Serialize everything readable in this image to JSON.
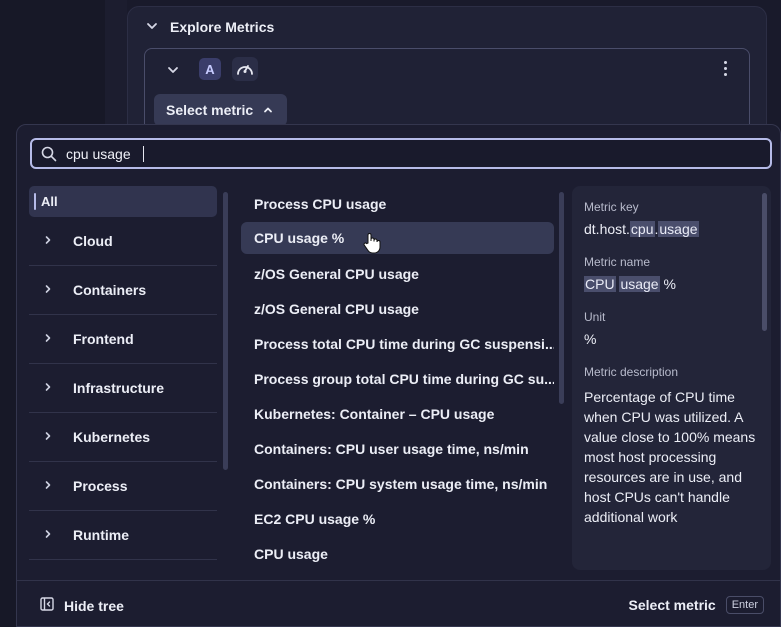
{
  "explore": {
    "title": "Explore Metrics",
    "query_badge": "A",
    "select_metric_label": "Select metric"
  },
  "search": {
    "value": "cpu usage"
  },
  "tree": {
    "all_label": "All",
    "items": [
      {
        "label": "Cloud"
      },
      {
        "label": "Containers"
      },
      {
        "label": "Frontend"
      },
      {
        "label": "Infrastructure"
      },
      {
        "label": "Kubernetes"
      },
      {
        "label": "Process"
      },
      {
        "label": "Runtime"
      }
    ]
  },
  "results": [
    {
      "label": "Process CPU usage"
    },
    {
      "label": "CPU usage %",
      "selected": true
    },
    {
      "label": "z/OS General CPU usage"
    },
    {
      "label": "z/OS General CPU usage"
    },
    {
      "label": "Process total CPU time during GC suspensi..."
    },
    {
      "label": "Process group total CPU time during GC su..."
    },
    {
      "label": "Kubernetes: Container – CPU usage"
    },
    {
      "label": "Containers: CPU user usage time, ns/min"
    },
    {
      "label": "Containers: CPU system usage time, ns/min"
    },
    {
      "label": "EC2 CPU usage %"
    },
    {
      "label": "CPU usage"
    }
  ],
  "details": {
    "metric_key_label": "Metric key",
    "metric_key_prefix": "dt.host.",
    "metric_key_hl1": "cpu",
    "metric_key_sep": ".",
    "metric_key_hl2": "usage",
    "metric_name_label": "Metric name",
    "metric_name_hl1": "CPU",
    "metric_name_hl2": "usage",
    "metric_name_suffix": " %",
    "unit_label": "Unit",
    "unit_value": "%",
    "description_label": "Metric description",
    "description": "Percentage of CPU time when CPU was utilized. A value close to 100% means most host processing resources are in use, and host CPUs can't handle additional work"
  },
  "footer": {
    "hide_tree_label": "Hide tree",
    "select_metric_label": "Select metric",
    "enter_key": "Enter"
  },
  "colors": {
    "background": "#191a2b",
    "panel": "#1c1d30",
    "selected_row": "#363a55",
    "search_border": "#b6bbe8"
  }
}
